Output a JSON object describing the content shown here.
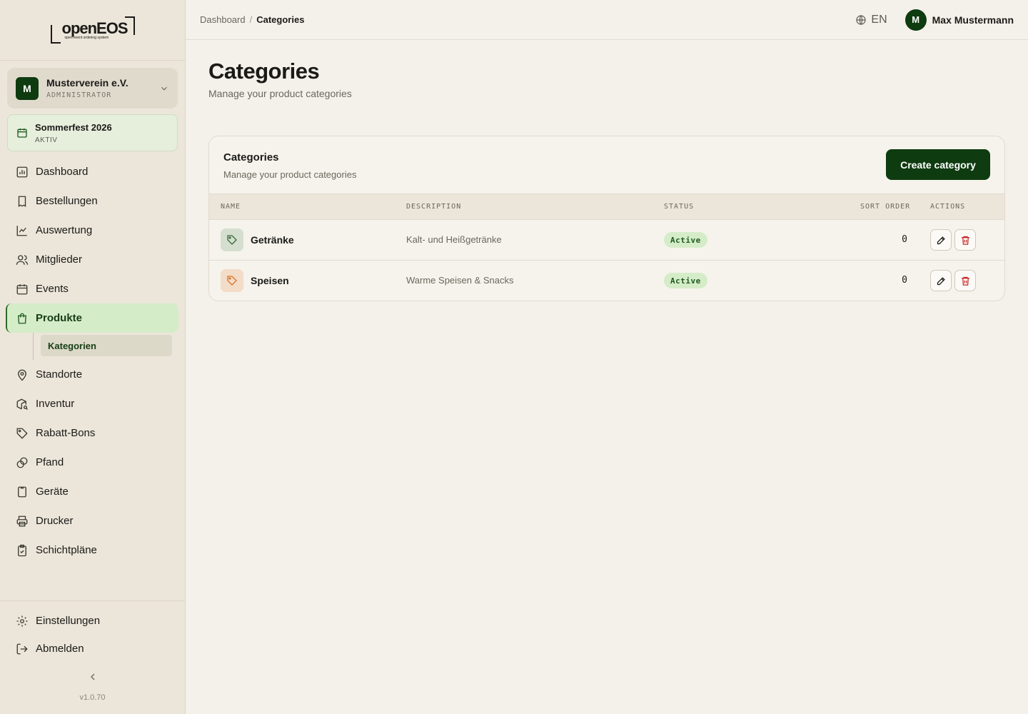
{
  "brand": {
    "logo_text": "openEOS",
    "logo_tagline": "open event ordering system"
  },
  "org": {
    "initial": "M",
    "name": "Musterverein e.V.",
    "role": "ADMINISTRATOR"
  },
  "event": {
    "name": "Sommerfest 2026",
    "status": "AKTIV"
  },
  "nav": {
    "items": [
      {
        "label": "Dashboard",
        "icon": "bar-chart-icon"
      },
      {
        "label": "Bestellungen",
        "icon": "receipt-icon"
      },
      {
        "label": "Auswertung",
        "icon": "line-chart-icon"
      },
      {
        "label": "Mitglieder",
        "icon": "users-icon"
      },
      {
        "label": "Events",
        "icon": "calendar-icon"
      },
      {
        "label": "Produkte",
        "icon": "shopping-bag-icon",
        "active": true
      },
      {
        "label": "Standorte",
        "icon": "map-pin-icon"
      },
      {
        "label": "Inventur",
        "icon": "package-search-icon"
      },
      {
        "label": "Rabatt-Bons",
        "icon": "tag-icon"
      },
      {
        "label": "Pfand",
        "icon": "link-icon"
      },
      {
        "label": "Geräte",
        "icon": "device-icon"
      },
      {
        "label": "Drucker",
        "icon": "printer-icon"
      },
      {
        "label": "Schichtpläne",
        "icon": "clipboard-check-icon"
      }
    ],
    "sub_item": "Kategorien",
    "settings": "Einstellungen",
    "logout": "Abmelden"
  },
  "version": "v1.0.70",
  "topbar": {
    "breadcrumb": [
      "Dashboard",
      "Categories"
    ],
    "language": "EN",
    "user_initial": "M",
    "user_name": "Max Mustermann"
  },
  "page": {
    "title": "Categories",
    "subtitle": "Manage your product categories"
  },
  "card": {
    "title": "Categories",
    "subtitle": "Manage your product categories",
    "create_button": "Create category",
    "columns": [
      "NAME",
      "DESCRIPTION",
      "STATUS",
      "SORT ORDER",
      "ACTIONS"
    ],
    "rows": [
      {
        "name": "Getränke",
        "description": "Kalt- und Heißgetränke",
        "status": "Active",
        "sort_order": "0",
        "icon_color": "#d5dfcf",
        "icon_stroke": "#3a6a3a"
      },
      {
        "name": "Speisen",
        "description": "Warme Speisen & Snacks",
        "status": "Active",
        "sort_order": "0",
        "icon_color": "#f3dcc8",
        "icon_stroke": "#d9742a"
      }
    ]
  },
  "colors": {
    "primary": "#0e3b10",
    "active_bg": "#d5ecc9",
    "danger": "#c62828",
    "background": "#f4f1ea"
  }
}
